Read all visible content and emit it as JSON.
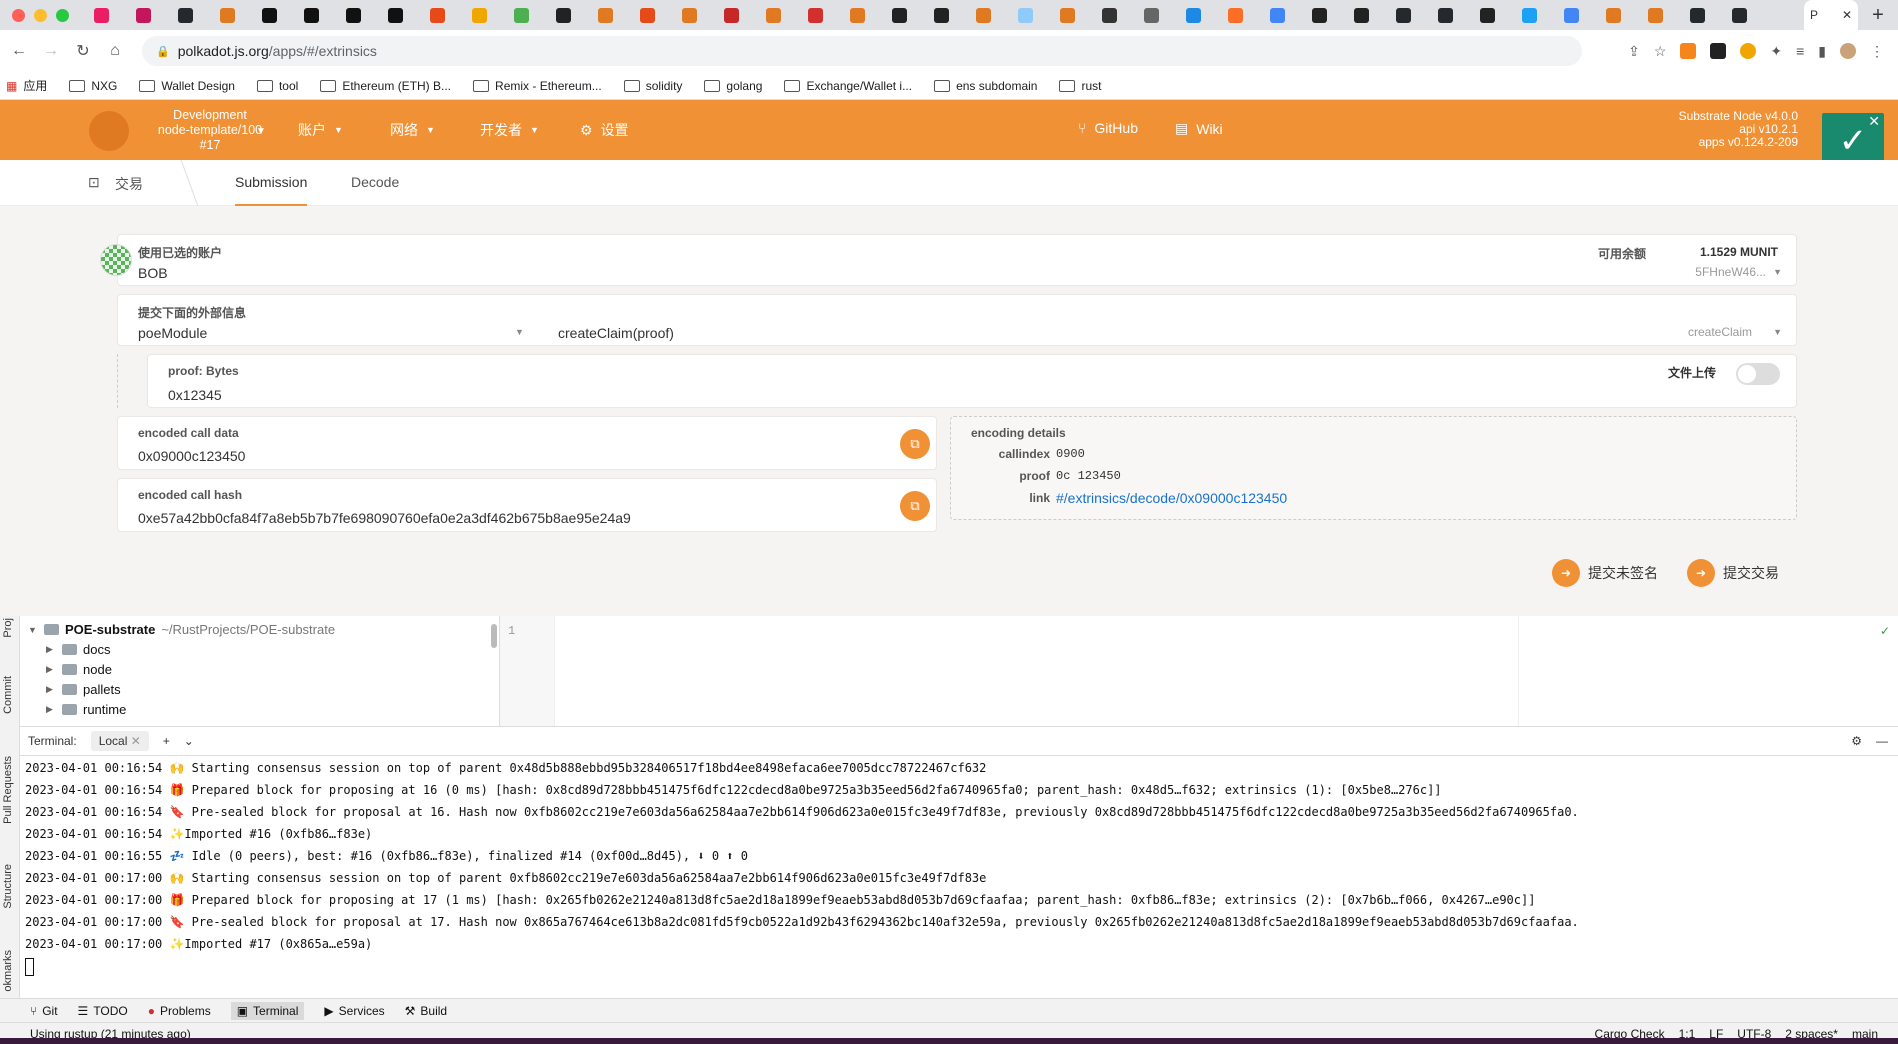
{
  "browser": {
    "active_tab_title": "P",
    "tab_count": 40,
    "url_host": "polkadot.js.org",
    "url_path": "/apps/#/extrinsics",
    "bookmarks": [
      "应用",
      "NXG",
      "Wallet Design",
      "tool",
      "Ethereum (ETH) B...",
      "Remix - Ethereum...",
      "solidity",
      "golang",
      "Exchange/Wallet i...",
      "ens subdomain",
      "rust"
    ]
  },
  "header": {
    "chain_line1": "Development",
    "chain_line2": "node-template/100",
    "chain_line3": "#17",
    "menu_accounts": "账户",
    "menu_network": "网络",
    "menu_developer": "开发者",
    "menu_settings": "设置",
    "link_github": "GitHub",
    "link_wiki": "Wiki",
    "version1": "Substrate Node v4.0.0",
    "version2": "api v10.2.1",
    "version3": "apps v0.124.2-209",
    "accent_color": "#f19135"
  },
  "subnav": {
    "section": "交易",
    "tab_submission": "Submission",
    "tab_decode": "Decode"
  },
  "form": {
    "account_label": "使用已选的账户",
    "account_name": "BOB",
    "balance_label": "可用余额",
    "balance_value": "1.1529 MUNIT",
    "account_address": "5FHneW46...",
    "extrinsic_label": "提交下面的外部信息",
    "module": "poeModule",
    "call": "createClaim(proof)",
    "call_short": "createClaim",
    "param_label": "proof: Bytes",
    "param_value": "0x12345",
    "file_upload_label": "文件上传",
    "encoded_call_data_label": "encoded call data",
    "encoded_call_data": "0x09000c123450",
    "encoded_call_hash_label": "encoded call hash",
    "encoded_call_hash": "0xe57a42bb0cfa84f7a8eb5b7b7fe698090760efa0e2a3df462b675b8ae95e24a9",
    "encoding_details_label": "encoding details",
    "callindex_label": "callindex",
    "callindex_value": "0900",
    "proof_label": "proof",
    "proof_value": "0c 123450",
    "link_label": "link",
    "link_value": "#/extrinsics/decode/0x09000c123450",
    "submit_unsigned": "提交未签名",
    "submit": "提交交易"
  },
  "ide": {
    "project_name": "POE-substrate",
    "project_path": "~/RustProjects/POE-substrate",
    "folders": [
      "docs",
      "node",
      "pallets",
      "runtime"
    ],
    "side_labels": [
      "Proj",
      "Commit",
      "Pull Requests",
      "Structure",
      "okmarks"
    ],
    "line_number": "1",
    "terminal_label": "Terminal:",
    "terminal_tab": "Local",
    "terminal_lines": [
      "2023-04-01 00:16:54 🙌 Starting consensus session on top of parent 0x48d5b888ebbd95b328406517f18bd4ee8498efaca6ee7005dcc78722467cf632",
      "2023-04-01 00:16:54 🎁 Prepared block for proposing at 16 (0 ms) [hash: 0x8cd89d728bbb451475f6dfc122cdecd8a0be9725a3b35eed56d2fa6740965fa0; parent_hash: 0x48d5…f632; extrinsics (1): [0x5be8…276c]]",
      "2023-04-01 00:16:54 🔖 Pre-sealed block for proposal at 16. Hash now 0xfb8602cc219e7e603da56a62584aa7e2bb614f906d623a0e015fc3e49f7df83e, previously 0x8cd89d728bbb451475f6dfc122cdecd8a0be9725a3b35eed56d2fa6740965fa0.",
      "2023-04-01 00:16:54 ✨Imported #16 (0xfb86…f83e)",
      "2023-04-01 00:16:55 💤 Idle (0 peers), best: #16 (0xfb86…f83e), finalized #14 (0xf00d…8d45), ⬇ 0 ⬆ 0",
      "2023-04-01 00:17:00 🙌 Starting consensus session on top of parent 0xfb8602cc219e7e603da56a62584aa7e2bb614f906d623a0e015fc3e49f7df83e",
      "2023-04-01 00:17:00 🎁 Prepared block for proposing at 17 (1 ms) [hash: 0x265fb0262e21240a813d8fc5ae2d18a1899ef9eaeb53abd8d053b7d69cfaafaa; parent_hash: 0xfb86…f83e; extrinsics (2): [0x7b6b…f066, 0x4267…e90c]]",
      "2023-04-01 00:17:00 🔖 Pre-sealed block for proposal at 17. Hash now 0x865a767464ce613b8a2dc081fd5f9cb0522a1d92b43f6294362bc140af32e59a, previously 0x265fb0262e21240a813d8fc5ae2d18a1899ef9eaeb53abd8d053b7d69cfaafaa.",
      "2023-04-01 00:17:00 ✨Imported #17 (0x865a…e59a)"
    ],
    "bottom_tabs": [
      "Git",
      "TODO",
      "Problems",
      "Terminal",
      "Services",
      "Build"
    ],
    "status_left": "Using rustup (21 minutes ago)",
    "status_right": [
      "Cargo Check",
      "1:1",
      "LF",
      "UTF-8",
      "2 spaces*",
      "main"
    ]
  }
}
